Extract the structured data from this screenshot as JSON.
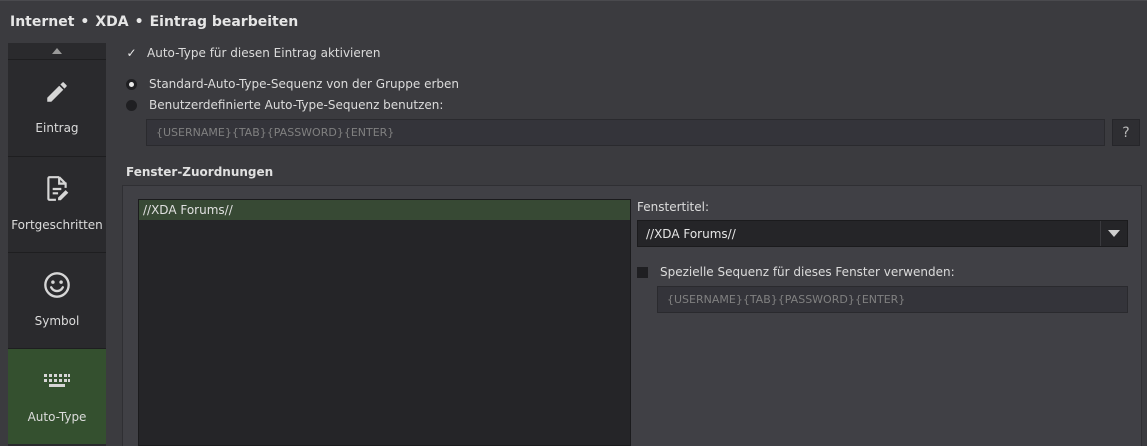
{
  "header": {
    "breadcrumb": [
      "Internet",
      "XDA",
      "Eintrag bearbeiten"
    ],
    "separator": "•"
  },
  "sidebar": {
    "items": [
      {
        "label": "Eintrag",
        "icon": "pencil-icon",
        "active": false
      },
      {
        "label": "Fortgeschritten",
        "icon": "document-edit-icon",
        "active": false
      },
      {
        "label": "Symbol",
        "icon": "smiley-icon",
        "active": false
      },
      {
        "label": "Auto-Type",
        "icon": "keyboard-icon",
        "active": true
      }
    ]
  },
  "autotype": {
    "enable_label": "Auto-Type für diesen Eintrag aktivieren",
    "enable_checked": true,
    "inherit_label": "Standard-Auto-Type-Sequenz von der Gruppe erben",
    "custom_label": "Benutzerdefinierte Auto-Type-Sequenz benutzen:",
    "selected_option": "inherit",
    "sequence_placeholder": "{USERNAME}{TAB}{PASSWORD}{ENTER}",
    "help_label": "?"
  },
  "window_assoc": {
    "section_title": "Fenster-Zuordnungen",
    "windows": [
      "//XDA Forums//"
    ],
    "window_title_label": "Fenstertitel:",
    "window_title_value": "//XDA Forums//",
    "special_seq_label": "Spezielle Sequenz für dieses Fenster verwenden:",
    "special_seq_checked": false,
    "special_seq_placeholder": "{USERNAME}{TAB}{PASSWORD}{ENTER}"
  },
  "colors": {
    "background": "#3b3b3f",
    "sidebar": "#2a2a2d",
    "active_nav": "#34502f",
    "selected_row": "#374934"
  }
}
